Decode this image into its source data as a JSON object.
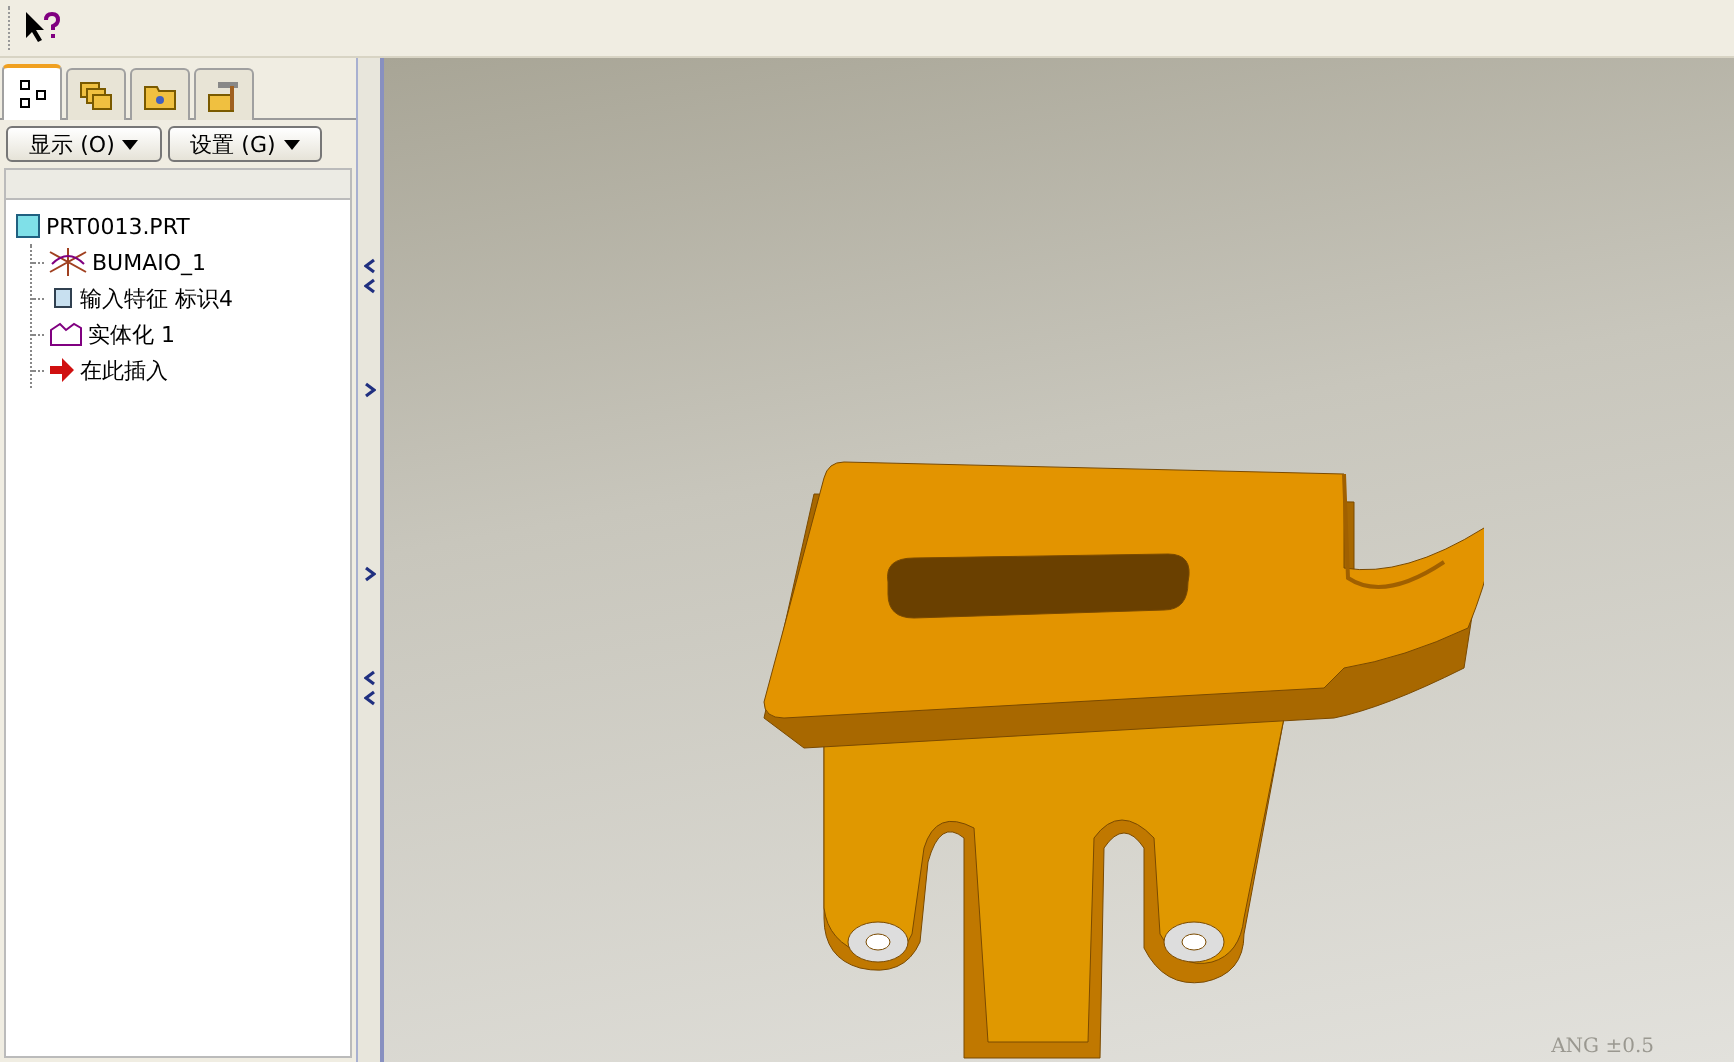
{
  "toolbar": {
    "items": [
      {
        "kind": "whats-this"
      }
    ]
  },
  "panel_tabs": [
    {
      "kind": "tree",
      "selected": true
    },
    {
      "kind": "layers",
      "selected": false
    },
    {
      "kind": "folder",
      "selected": false
    },
    {
      "kind": "tools",
      "selected": false
    }
  ],
  "panel_buttons": [
    {
      "label": "显示 (O)"
    },
    {
      "label": "设置 (G)"
    }
  ],
  "model_tree": {
    "items": [
      {
        "label": "PRT0013.PRT",
        "kind": "part",
        "children": [
          {
            "label": "BUMAIO_1",
            "kind": "datum-curve"
          },
          {
            "label": "输入特征 标识4",
            "kind": "import"
          },
          {
            "label": "实体化 1",
            "kind": "solidify"
          },
          {
            "label": "在此插入",
            "kind": "insert"
          }
        ]
      }
    ]
  },
  "viewport": {
    "note": "ANG ±0.5"
  }
}
